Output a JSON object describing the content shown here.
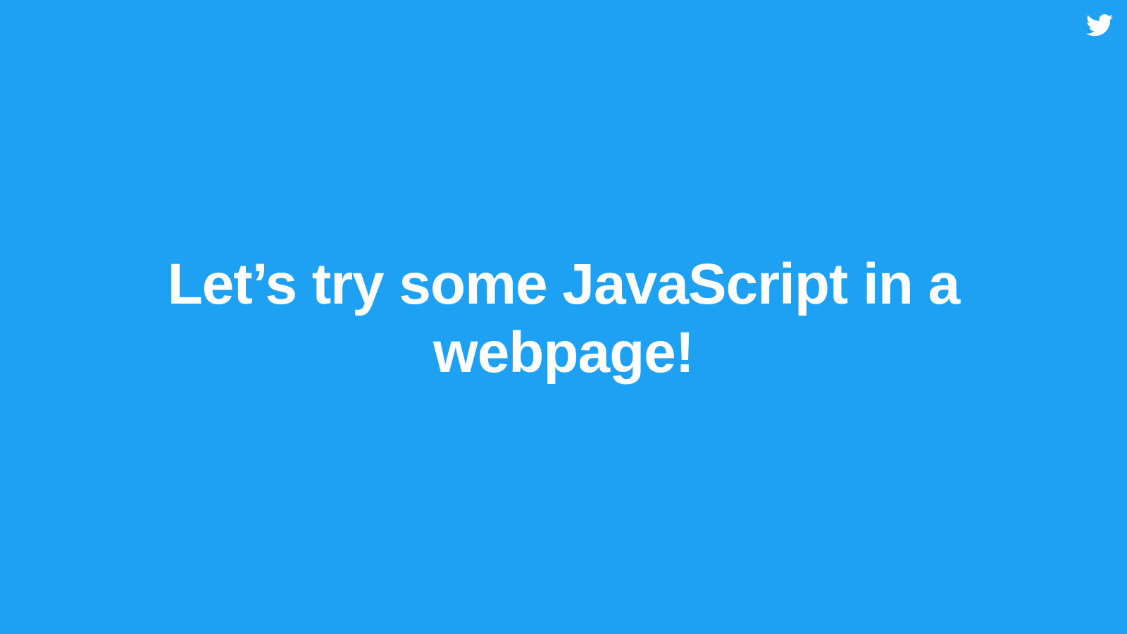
{
  "slide": {
    "title": "Let’s try some JavaScript in a webpage!",
    "logo_icon": "twitter-bird-icon",
    "background_color": "#1ea1f2",
    "text_color": "#ffffff"
  }
}
